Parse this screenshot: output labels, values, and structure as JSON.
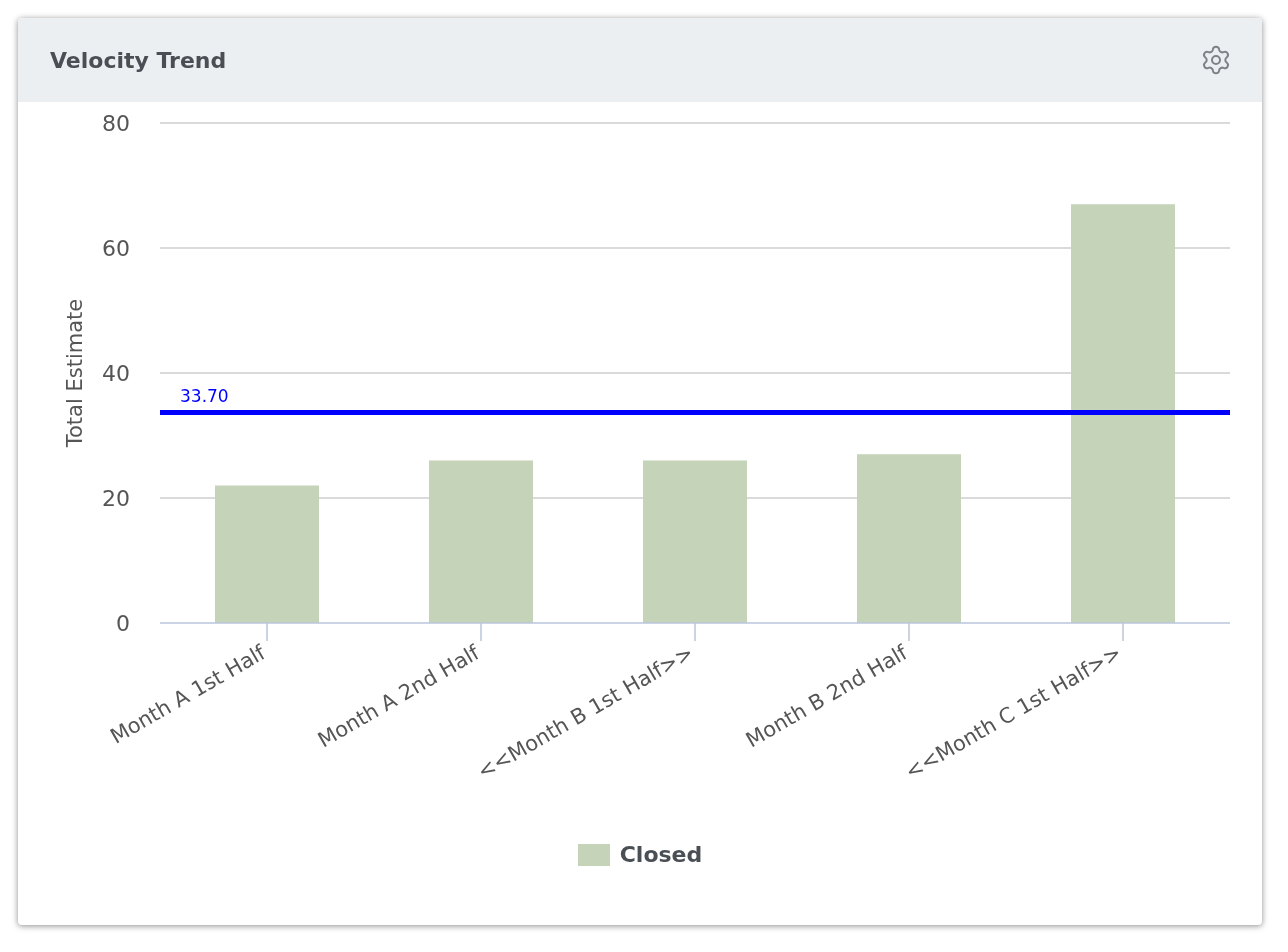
{
  "card": {
    "title": "Velocity Trend"
  },
  "chart_data": {
    "type": "bar",
    "ylabel": "Total Estimate",
    "categories": [
      "Month A 1st Half",
      "Month A 2nd Half",
      "<<Month B 1st Half>>",
      "Month B 2nd Half",
      "<<Month C 1st Half>>"
    ],
    "series": [
      {
        "name": "Closed",
        "color": "#c5d3b9",
        "values": [
          22,
          26,
          26,
          27,
          67
        ]
      }
    ],
    "ylim": [
      0,
      80
    ],
    "yticks": [
      0,
      20,
      40,
      60,
      80
    ],
    "grid": true,
    "ref_lines": [
      {
        "axis": "y",
        "value": 33.7,
        "label": "33.70",
        "color": "#0000ff"
      }
    ]
  }
}
